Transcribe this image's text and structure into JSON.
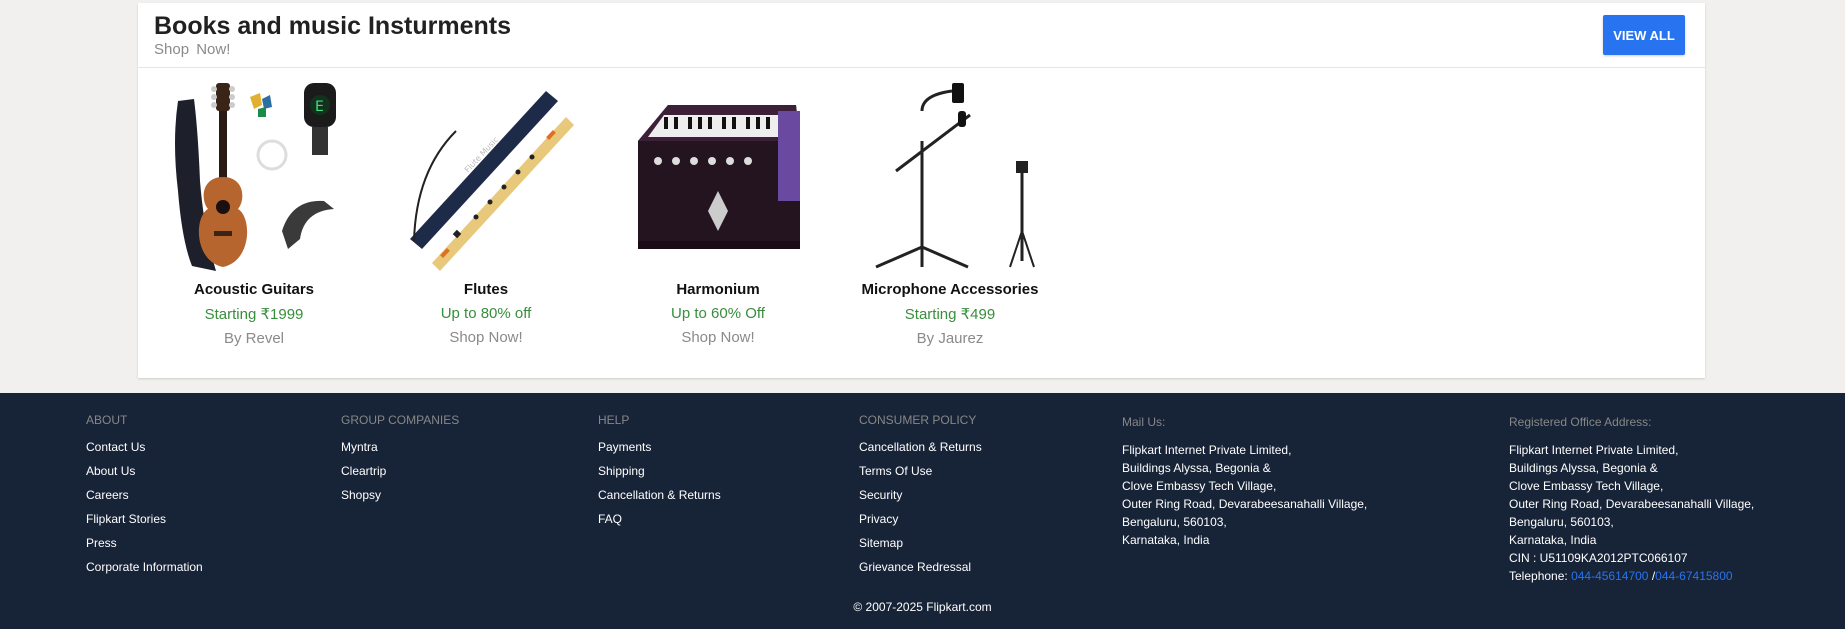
{
  "section": {
    "title": "Books and music Insturments",
    "subtitle": "Shop  Now!",
    "view_all": "VIEW ALL"
  },
  "products": [
    {
      "name": "Acoustic Guitars",
      "offer": "Starting ₹1999",
      "sub": "By Revel",
      "icon": "guitar-image"
    },
    {
      "name": "Flutes",
      "offer": "Up to 80% off",
      "sub": "Shop Now!",
      "icon": "flute-image"
    },
    {
      "name": "Harmonium",
      "offer": "Up to 60% Off",
      "sub": "Shop Now!",
      "icon": "harmonium-image"
    },
    {
      "name": "Microphone Accessories",
      "offer": "Starting ₹499",
      "sub": "By Jaurez",
      "icon": "microphone-stand-image"
    }
  ],
  "footer": {
    "about": {
      "heading": "ABOUT",
      "links": [
        "Contact Us",
        "About Us",
        "Careers",
        "Flipkart Stories",
        "Press",
        "Corporate Information"
      ]
    },
    "group": {
      "heading": "GROUP COMPANIES",
      "links": [
        "Myntra",
        "Cleartrip",
        "Shopsy"
      ]
    },
    "help": {
      "heading": "HELP",
      "links": [
        "Payments",
        "Shipping",
        "Cancellation & Returns",
        "FAQ"
      ]
    },
    "policy": {
      "heading": "CONSUMER POLICY",
      "links": [
        "Cancellation & Returns",
        "Terms Of Use",
        "Security",
        "Privacy",
        "Sitemap",
        "Grievance Redressal"
      ]
    },
    "mail": {
      "heading": "Mail Us:",
      "lines": [
        "Flipkart Internet Private Limited,",
        "Buildings Alyssa, Begonia &",
        "Clove Embassy Tech Village,",
        "Outer Ring Road, Devarabeesanahalli Village,",
        "Bengaluru, 560103,",
        "Karnataka, India"
      ]
    },
    "office": {
      "heading": "Registered Office Address:",
      "lines": [
        "Flipkart Internet Private Limited,",
        "Buildings Alyssa, Begonia &",
        "Clove Embassy Tech Village,",
        "Outer Ring Road, Devarabeesanahalli Village,",
        "Bengaluru, 560103,",
        "Karnataka, India",
        "CIN : U51109KA2012PTC066107"
      ],
      "telephone_label": "Telephone: ",
      "phone1": "044-45614700",
      "separator": " /",
      "phone2": "044-67415800"
    },
    "copyright": "© 2007-2025 Flipkart.com"
  },
  "colors": {
    "accent": "#2874f0",
    "offer_green": "#388e3c",
    "footer_bg": "#172337"
  }
}
